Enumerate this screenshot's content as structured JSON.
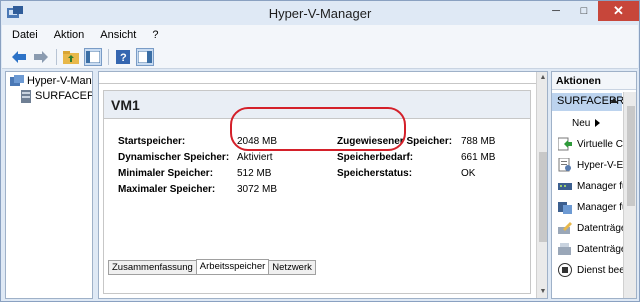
{
  "window": {
    "title": "Hyper-V-Manager",
    "controls": {
      "minimize": "─",
      "maximize": "□",
      "close": "✕"
    }
  },
  "menu": [
    "Datei",
    "Aktion",
    "Ansicht",
    "?"
  ],
  "toolbar": {
    "icons": [
      "back-arrow-icon",
      "forward-arrow-icon",
      "folder-up-icon",
      "console-tree-icon",
      "help-icon",
      "pane-toggle-icon"
    ]
  },
  "tree": {
    "root": "Hyper-V-Manager",
    "server": "SURFACEPRO"
  },
  "vm": {
    "name": "VM1",
    "left_fields": [
      {
        "label": "Startspeicher:",
        "value": "2048 MB"
      },
      {
        "label": "Dynamischer Speicher:",
        "value": "Aktiviert"
      },
      {
        "label": "Minimaler Speicher:",
        "value": "512 MB"
      },
      {
        "label": "Maximaler Speicher:",
        "value": "3072 MB"
      }
    ],
    "right_fields": [
      {
        "label": "Zugewiesener Speicher:",
        "value": "788 MB"
      },
      {
        "label": "Speicherbedarf:",
        "value": "661 MB"
      },
      {
        "label": "Speicherstatus:",
        "value": "OK"
      }
    ],
    "tabs": [
      "Zusammenfassung",
      "Arbeitsspeicher",
      "Netzwerk"
    ],
    "active_tab": "Arbeitsspeicher"
  },
  "actions": {
    "header": "Aktionen",
    "group": "SURFACEPRO",
    "items": [
      {
        "label": "Neu",
        "icon": "submenu-arrow-icon"
      },
      {
        "label": "Virtuelle Computer importieren...",
        "icon": "import-icon"
      },
      {
        "label": "Hyper-V-Einstellungen...",
        "icon": "settings-icon"
      },
      {
        "label": "Manager für virtuelle Switches...",
        "icon": "switch-manager-icon"
      },
      {
        "label": "Manager für virtuelle SANs...",
        "icon": "san-manager-icon"
      },
      {
        "label": "Datenträger bearbeiten...",
        "icon": "edit-disk-icon"
      },
      {
        "label": "Datenträger überprüfen...",
        "icon": "inspect-disk-icon"
      },
      {
        "label": "Dienst beenden",
        "icon": "stop-service-icon"
      }
    ]
  },
  "colors": {
    "highlight": "#d4202a",
    "selection": "#bcd3ee",
    "close_button": "#c7463a"
  }
}
